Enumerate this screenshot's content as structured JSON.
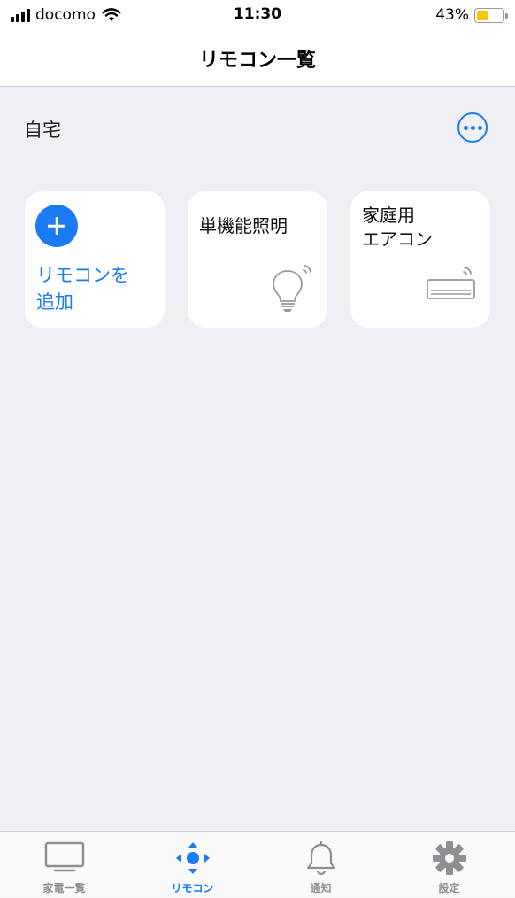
{
  "status_bar": {
    "carrier": "docomo",
    "time": "11:30",
    "battery_percent": "43%",
    "battery_level": 0.43
  },
  "nav": {
    "title": "リモコン一覧"
  },
  "section": {
    "title": "自宅",
    "more_icon": "ellipsis-circle-icon"
  },
  "cards": [
    {
      "label": "リモコンを\n追加",
      "icon": "plus-circle-icon"
    },
    {
      "label": "単機能照明",
      "icon": "light-bulb-icon"
    },
    {
      "label": "家庭用\nエアコン",
      "icon": "air-conditioner-icon"
    }
  ],
  "tabs": [
    {
      "label": "家電一覧",
      "icon": "tv-icon",
      "active": false
    },
    {
      "label": "リモコン",
      "icon": "dpad-icon",
      "active": true
    },
    {
      "label": "通知",
      "icon": "bell-icon",
      "active": false
    },
    {
      "label": "設定",
      "icon": "gear-icon",
      "active": false
    }
  ],
  "colors": {
    "accent": "#1a7cf2",
    "background": "#efeff4",
    "card": "#ffffff",
    "inactive": "#8e8e93",
    "battery": "#f7c600"
  }
}
